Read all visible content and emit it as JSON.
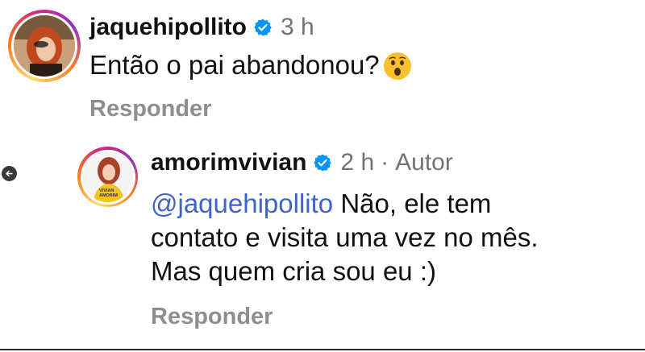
{
  "comments": [
    {
      "username": "jaquehipollito",
      "time": "3 h",
      "text": "Então o pai abandonou?",
      "emoji": "astonished-face-emoji",
      "reply_label": "Responder"
    },
    {
      "username": "amorimvivian",
      "time": "2 h",
      "separator": "·",
      "author_badge": "Autor",
      "mention": "@jaquehipollito",
      "text_line1": " Não, ele tem",
      "text_line2": "contato e visita uma vez no mês.",
      "text_line3": "Mas quem cria sou eu :)",
      "reply_label": "Responder",
      "avatar_shirt_text_1": "VIVIAN",
      "avatar_shirt_text_2": "AMORIM"
    }
  ],
  "icons": {
    "verified": "verified-badge-icon",
    "back": "arrow-left-icon"
  },
  "colors": {
    "verified_blue": "#0095f6",
    "mention_blue": "#3f63c8",
    "muted_gray": "#8e8e8e"
  }
}
